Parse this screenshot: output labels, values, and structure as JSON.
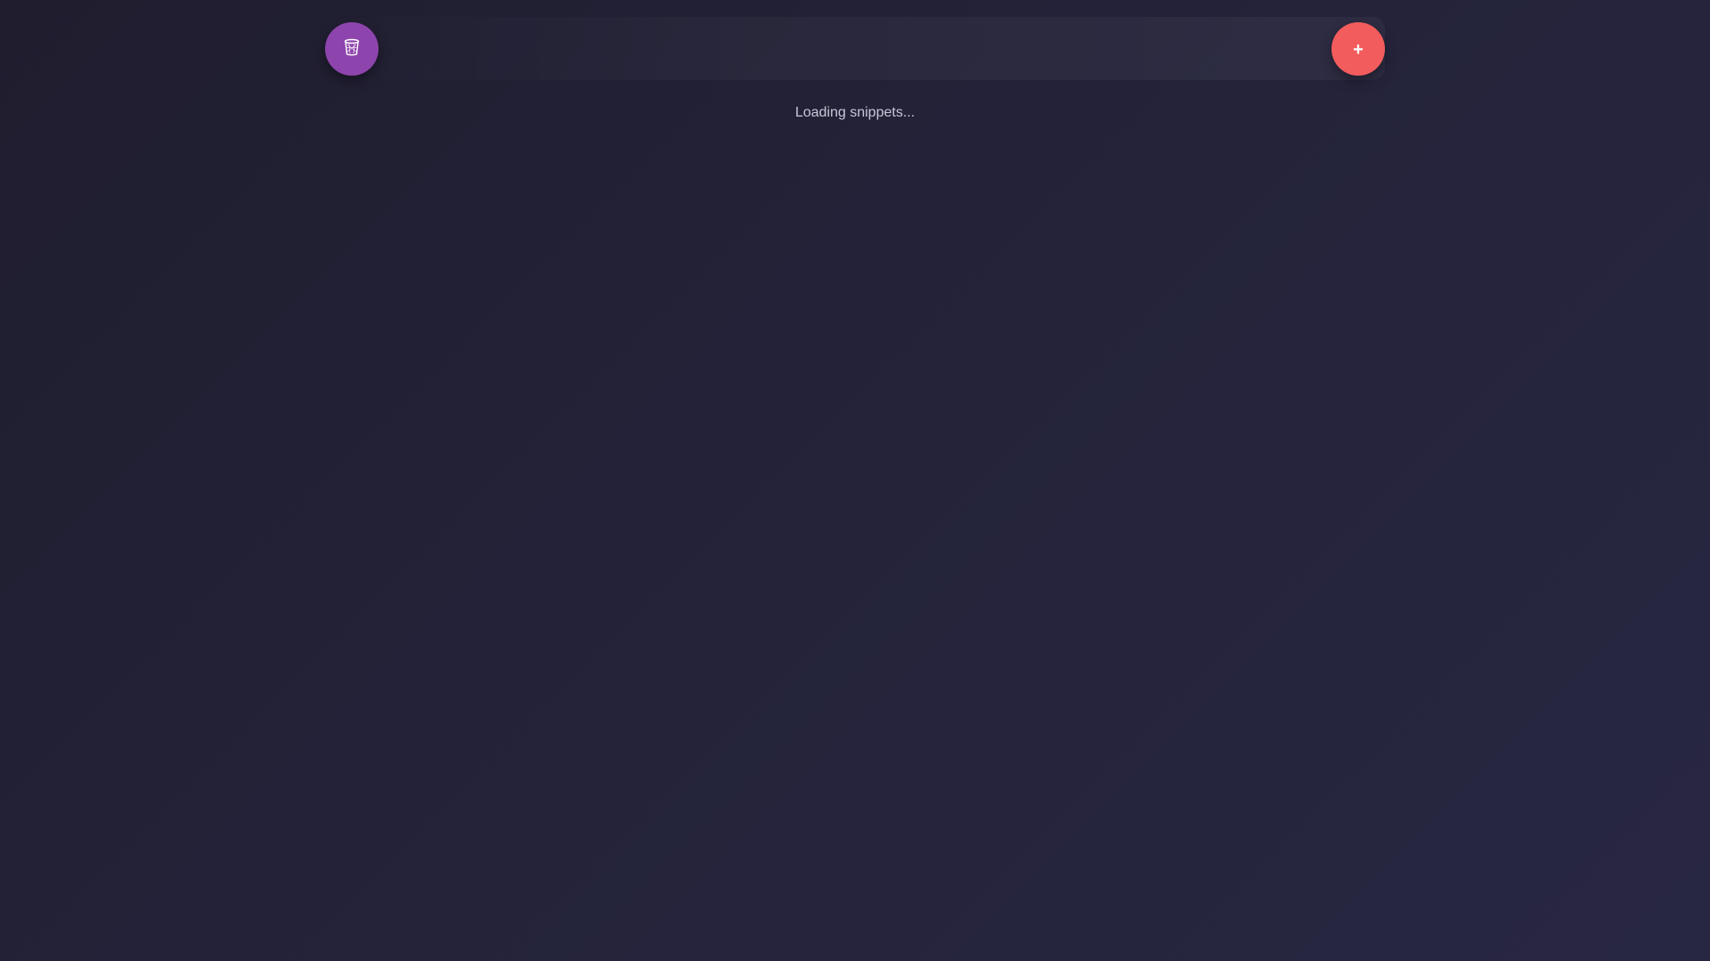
{
  "toolbar": {
    "trash_icon": "trash-icon",
    "add_label": "+",
    "colors": {
      "trash_button": "#8e44ad",
      "add_button": "#f25c5c"
    }
  },
  "main": {
    "status_text": "Loading snippets..."
  }
}
